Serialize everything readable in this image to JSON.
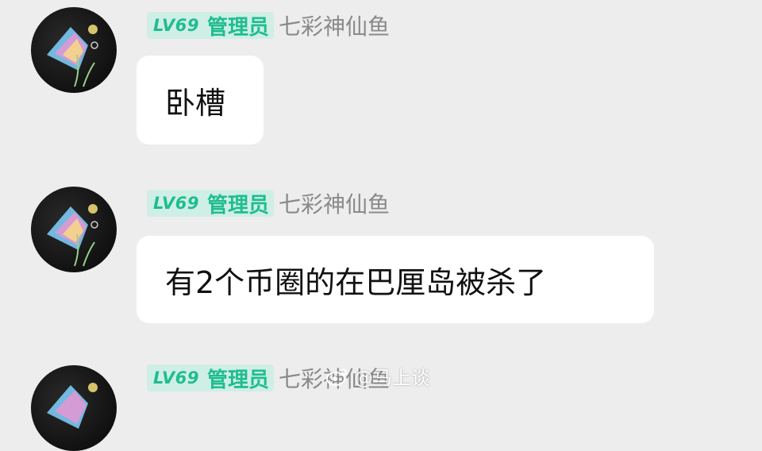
{
  "messages": [
    {
      "badge": {
        "level": "LV69",
        "role": "管理员"
      },
      "username": "七彩神仙鱼",
      "text": "卧槽"
    },
    {
      "badge": {
        "level": "LV69",
        "role": "管理员"
      },
      "username": "七彩神仙鱼",
      "text": "有2个币圈的在巴厘岛被杀了"
    },
    {
      "badge": {
        "level": "LV69",
        "role": "管理员"
      },
      "username": "七彩神仙鱼"
    }
  ],
  "watermark": {
    "text": "@马上谈",
    "icon": "weibo-icon"
  },
  "colors": {
    "background": "#ededed",
    "badge_bg": "#cfeee6",
    "badge_text": "#1fbd8f",
    "username": "#8a8a8a",
    "bubble": "#ffffff"
  }
}
